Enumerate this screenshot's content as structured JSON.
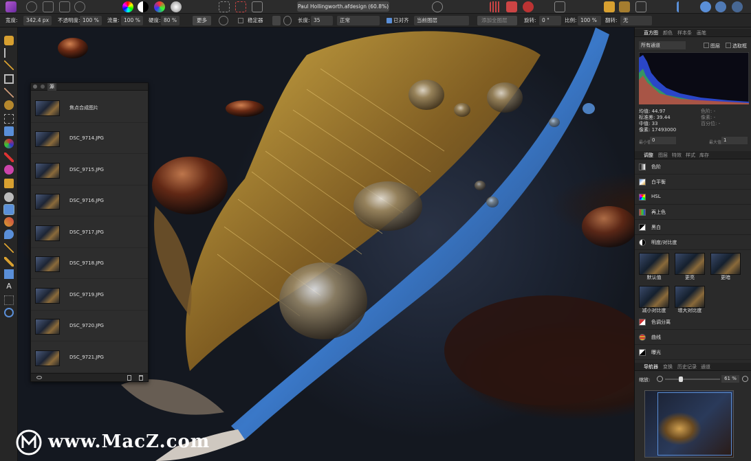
{
  "app": {
    "document_title": "Paul Hollingworth.afdesign (60.8%)"
  },
  "context_bar": {
    "width_label": "宽度:",
    "width_value": "342.4 px",
    "opacity_label": "不透明度:",
    "opacity_value": "100 %",
    "flow_label": "流量:",
    "flow_value": "100 %",
    "hardness_label": "硬度:",
    "hardness_value": "80 %",
    "more_button": "更多",
    "stabilizer_label": "稳定器",
    "length_label": "长度:",
    "length_value": "35",
    "blend_mode": "正常",
    "aligned_label": "已对齐",
    "source_select": "当前图层",
    "add_all_layers": "添加全图层",
    "rotation_label": "旋转:",
    "rotation_value": "0 °",
    "scale_label": "比例:",
    "scale_value": "100 %",
    "flip_label": "翻转:",
    "flip_value": "无"
  },
  "sources_panel": {
    "tab_label": "源",
    "items": [
      {
        "label": "焦点合成图片"
      },
      {
        "label": "DSC_9714.JPG"
      },
      {
        "label": "DSC_9715.JPG"
      },
      {
        "label": "DSC_9716.JPG"
      },
      {
        "label": "DSC_9717.JPG"
      },
      {
        "label": "DSC_9718.JPG"
      },
      {
        "label": "DSC_9719.JPG"
      },
      {
        "label": "DSC_9720.JPG"
      },
      {
        "label": "DSC_9721.JPG"
      }
    ]
  },
  "histogram_panel": {
    "tabs": [
      "直方图",
      "颜色",
      "样本条",
      "画笔"
    ],
    "channel_select": "所有通道",
    "layer_checkbox": "图层",
    "selection_checkbox": "选取框",
    "stats_left": [
      "均值: 44.97",
      "标准差: 39.44",
      "中值: 33",
      "像素: 17493000"
    ],
    "stats_right": [
      "色阶: -",
      "像素: -",
      "百分位: -"
    ],
    "min_label": "最小值",
    "min_value": "0",
    "max_label": "最大值",
    "max_value": "1"
  },
  "adjust_panel": {
    "tabs": [
      "调整",
      "图层",
      "特效",
      "样式",
      "库存"
    ],
    "items_top": [
      "色阶",
      "白平衡",
      "HSL",
      "再上色",
      "黑白",
      "明度/对比度"
    ],
    "presets": [
      "默认值",
      "更亮",
      "更暗",
      "减小对比度",
      "增大对比度"
    ],
    "items_bottom": [
      "色调分离",
      "曲线",
      "曝光"
    ]
  },
  "navigator_panel": {
    "tabs": [
      "导航器",
      "变换",
      "历史记录",
      "通道"
    ],
    "zoom_label": "缩放:",
    "zoom_value": "61 %"
  },
  "watermark": {
    "text": "www.MacZ.com"
  },
  "colors": {
    "accent": "#5a8fd8",
    "panel": "#2a2a2a",
    "toolbar": "#2c2c2c"
  }
}
